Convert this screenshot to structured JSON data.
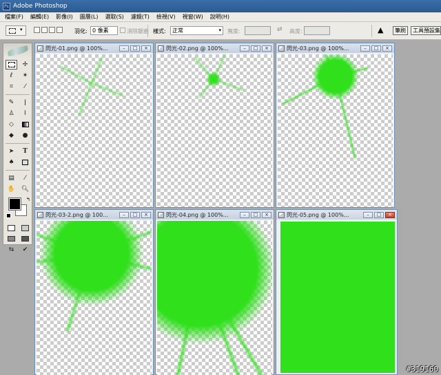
{
  "app": {
    "title": "Adobe Photoshop"
  },
  "menu": [
    "檔案(F)",
    "編輯(E)",
    "影像(I)",
    "圖層(L)",
    "選取(S)",
    "濾鏡(T)",
    "檢視(V)",
    "視窗(W)",
    "說明(H)"
  ],
  "options": {
    "feather_label": "羽化:",
    "feather_value": "0 像素",
    "antialias_label": "消除鋸齒",
    "style_label": "樣式:",
    "style_value": "正常",
    "width_label": "寬度:",
    "height_label": "高度:",
    "palette_tab_1": "筆刷",
    "palette_tab_2": "工具預設集"
  },
  "documents": [
    {
      "title": "閃光-01.png @ 100%..."
    },
    {
      "title": "閃光-02.png @ 100%..."
    },
    {
      "title": "閃光-03.png @ 100%..."
    },
    {
      "title": "閃光-03-2.png @ 100..."
    },
    {
      "title": "閃光-04.png @ 100%..."
    },
    {
      "title": "閃光-05.png @ 100%..."
    }
  ],
  "colors": {
    "flash_green": "#2fe01b",
    "foreground": "#000000",
    "background": "#ffffff"
  },
  "watermark": "#319160"
}
